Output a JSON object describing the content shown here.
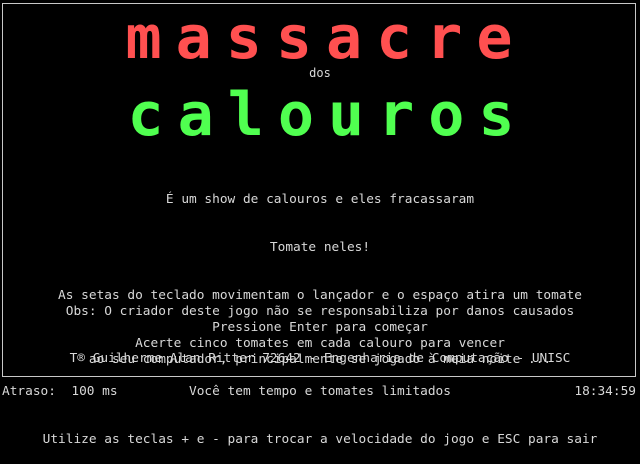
{
  "title": {
    "line1": "massacre",
    "connector": "dos",
    "line2": "calouros",
    "color1": "#ff5050",
    "color2": "#50ff50"
  },
  "intro": [
    "É um show de calouros e eles fracassaram",
    "Tomate neles!",
    "As setas do teclado movimentam o lançador e o espaço atira um tomate",
    "Acerte cinco tomates em cada calouro para vencer",
    "Você tem tempo e tomates limitados",
    "Utilize as teclas + e - para trocar a velocidade do jogo e ESC para sair"
  ],
  "disclaimer": [
    "Obs: O criador deste jogo não se responsabiliza por danos causados",
    "ao seu computador, principalmente se jogado à meia noite ..."
  ],
  "prompt": "Pressione Enter para começar",
  "credit": "T® Guilherme Alan Ritter 72642 - Engenharia de Computação - UNISC",
  "status": {
    "delay_label": "Atraso:",
    "delay_value": "100 ms",
    "clock": "18:34:59"
  }
}
